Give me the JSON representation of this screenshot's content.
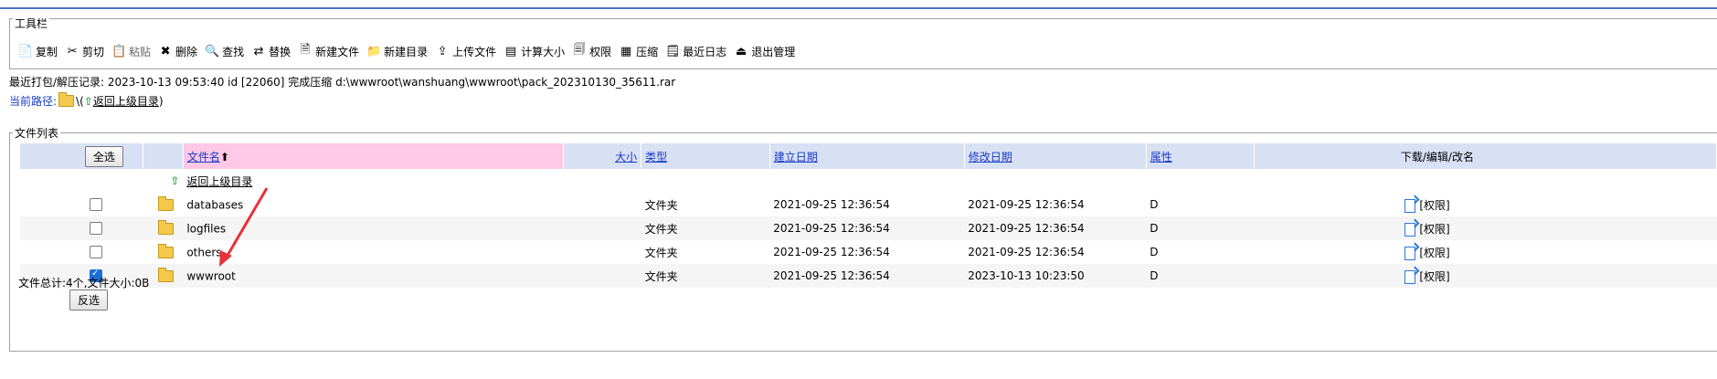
{
  "toolbar": {
    "legend": "工具栏",
    "buttons": [
      {
        "label": "复制",
        "icon": "copy-icon",
        "glyph": "📄"
      },
      {
        "label": "剪切",
        "icon": "cut-icon",
        "glyph": "✂"
      },
      {
        "label": "粘贴",
        "icon": "paste-icon",
        "glyph": "📋",
        "disabled": true
      },
      {
        "label": "删除",
        "icon": "delete-icon",
        "glyph": "✖"
      },
      {
        "label": "查找",
        "icon": "search-icon",
        "glyph": "🔍"
      },
      {
        "label": "替换",
        "icon": "replace-icon",
        "glyph": "⇄"
      },
      {
        "label": "新建文件",
        "icon": "new-file-icon",
        "glyph": "🗎"
      },
      {
        "label": "新建目录",
        "icon": "new-folder-icon",
        "glyph": "📁"
      },
      {
        "label": "上传文件",
        "icon": "upload-icon",
        "glyph": "⇪"
      },
      {
        "label": "计算大小",
        "icon": "calc-size-icon",
        "glyph": "▤"
      },
      {
        "label": "权限",
        "icon": "permission-icon",
        "glyph": "🗐"
      },
      {
        "label": "压缩",
        "icon": "compress-icon",
        "glyph": "▦"
      },
      {
        "label": "最近日志",
        "icon": "log-icon",
        "glyph": "🗒"
      },
      {
        "label": "退出管理",
        "icon": "exit-icon",
        "glyph": "⏏"
      }
    ]
  },
  "info": {
    "last_pack": "最近打包/解压记录: 2023-10-13 09:53:40 id [22060] 完成压缩 d:\\wwwroot\\wanshuang\\wwwroot\\pack_202310130_35611.rar"
  },
  "path": {
    "label": "当前路径:",
    "sep": "\\(",
    "back": "返回上级目录",
    "close": ")"
  },
  "filelist": {
    "legend": "文件列表",
    "select_all": "全选",
    "invert": "反选",
    "headers": {
      "name": "文件名",
      "sort_arrow": "⬆",
      "size": "大小",
      "type": "类型",
      "created": "建立日期",
      "modified": "修改日期",
      "attr": "属性",
      "actions": "下载/编辑/改名"
    },
    "back_row": "返回上级目录",
    "rows": [
      {
        "name": "databases",
        "type": "文件夹",
        "created": "2021-09-25 12:36:54",
        "modified": "2021-09-25 12:36:54",
        "attr": "D",
        "perm": "[权限]",
        "checked": false
      },
      {
        "name": "logfiles",
        "type": "文件夹",
        "created": "2021-09-25 12:36:54",
        "modified": "2021-09-25 12:36:54",
        "attr": "D",
        "perm": "[权限]",
        "checked": false
      },
      {
        "name": "others",
        "type": "文件夹",
        "created": "2021-09-25 12:36:54",
        "modified": "2021-09-25 12:36:54",
        "attr": "D",
        "perm": "[权限]",
        "checked": false
      },
      {
        "name": "wwwroot",
        "type": "文件夹",
        "created": "2021-09-25 12:36:54",
        "modified": "2023-10-13 10:23:50",
        "attr": "D",
        "perm": "[权限]",
        "checked": true
      }
    ],
    "summary": "文件总计:4个,文件大小:0B"
  },
  "colors": {
    "accent": "#4a72c4",
    "header_bg": "#d8e0f4",
    "name_header_bg": "#ffc8e6",
    "link": "#1a3cc6",
    "annotation_arrow": "#e8313a"
  }
}
